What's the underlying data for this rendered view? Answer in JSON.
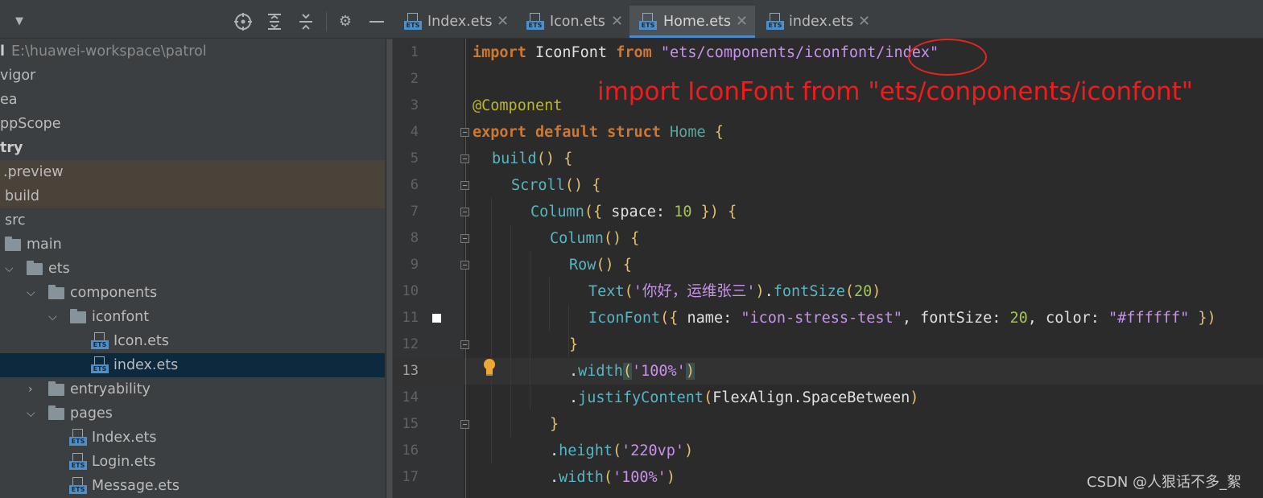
{
  "toolbar": {
    "dropdown_icon": "chevron-down-icon",
    "locate_icon": "crosshair-icon",
    "expand_icon": "expand-all-icon",
    "collapse_icon": "collapse-all-icon",
    "settings_icon": "gear-icon",
    "hide_icon": "minus-icon"
  },
  "tree": {
    "items": [
      {
        "label": "E:\\huawei-workspace\\patrol",
        "prefix": "l"
      },
      {
        "label": "vigor"
      },
      {
        "label": "ea"
      },
      {
        "label": "ppScope"
      },
      {
        "label": "try"
      },
      {
        "label": ".preview"
      },
      {
        "label": "build"
      },
      {
        "label": "src"
      },
      {
        "label": "main"
      },
      {
        "label": "ets"
      },
      {
        "label": "components"
      },
      {
        "label": "iconfont"
      },
      {
        "label": "Icon.ets"
      },
      {
        "label": "index.ets"
      },
      {
        "label": "entryability"
      },
      {
        "label": "pages"
      },
      {
        "label": "Index.ets"
      },
      {
        "label": "Login.ets"
      },
      {
        "label": "Message.ets"
      }
    ]
  },
  "file_tag": "ETS",
  "tabs": [
    {
      "label": "Index.ets"
    },
    {
      "label": "Icon.ets"
    },
    {
      "label": "Home.ets"
    },
    {
      "label": "index.ets"
    }
  ],
  "tab_close": "✕",
  "editor": {
    "line_numbers": [
      "1",
      "2",
      "3",
      "4",
      "5",
      "6",
      "7",
      "8",
      "9",
      "10",
      "11",
      "12",
      "13",
      "14",
      "15",
      "16",
      "17"
    ],
    "current_line": "13"
  },
  "annotation": {
    "note": "import IconFont from \"ets/conponents/iconfont\""
  },
  "watermark": "CSDN @人狠话不多_絮",
  "colors": {
    "annotation_red": "#e3261f",
    "selection": "#0d293e",
    "active_tab_underline": "#4a88c7"
  }
}
